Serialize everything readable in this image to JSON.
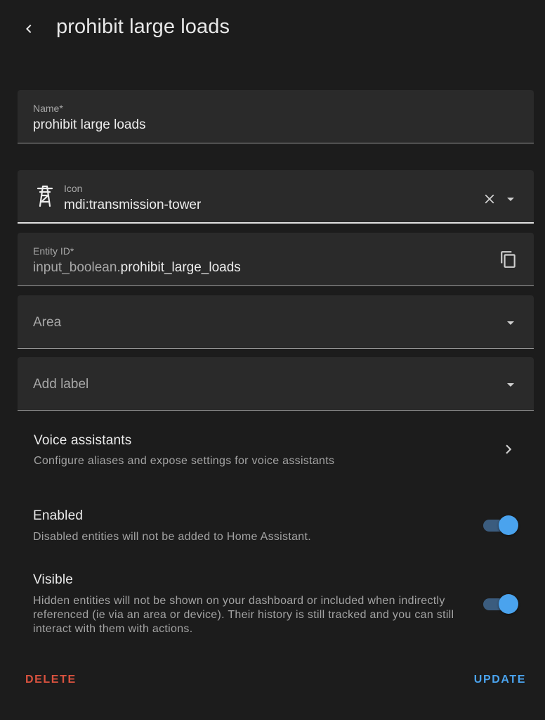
{
  "header": {
    "title": "prohibit large loads",
    "back_icon": "chevron-left-icon"
  },
  "form": {
    "name": {
      "label": "Name*",
      "value": "prohibit large loads"
    },
    "icon": {
      "label": "Icon",
      "value": "mdi:transmission-tower",
      "preview_icon": "transmission-tower-icon",
      "clear_icon": "close-icon",
      "dropdown_icon": "menu-down-icon"
    },
    "entity_id": {
      "label": "Entity ID*",
      "prefix": "input_boolean.",
      "value": "prohibit_large_loads",
      "copy_icon": "copy-icon"
    },
    "area": {
      "placeholder": "Area",
      "dropdown_icon": "menu-down-icon"
    },
    "labels": {
      "placeholder": "Add label",
      "dropdown_icon": "menu-down-icon"
    }
  },
  "voice_assistants": {
    "title": "Voice assistants",
    "subtitle": "Configure aliases and expose settings for voice assistants",
    "chevron_icon": "chevron-right-icon"
  },
  "enabled": {
    "title": "Enabled",
    "subtitle": "Disabled entities will not be added to Home Assistant.",
    "on": true
  },
  "visible": {
    "title": "Visible",
    "subtitle": "Hidden entities will not be shown on your dashboard or included when indirectly referenced (ie via an area or device). Their history is still tracked and you can still interact with them with actions.",
    "on": true
  },
  "actions": {
    "delete_label": "DELETE",
    "update_label": "UPDATE"
  },
  "colors": {
    "background": "#1c1c1c",
    "field_background": "#2a2a2a",
    "accent": "#4aa3ee",
    "danger": "#d9523f",
    "switch_track": "#3b5c7e"
  }
}
